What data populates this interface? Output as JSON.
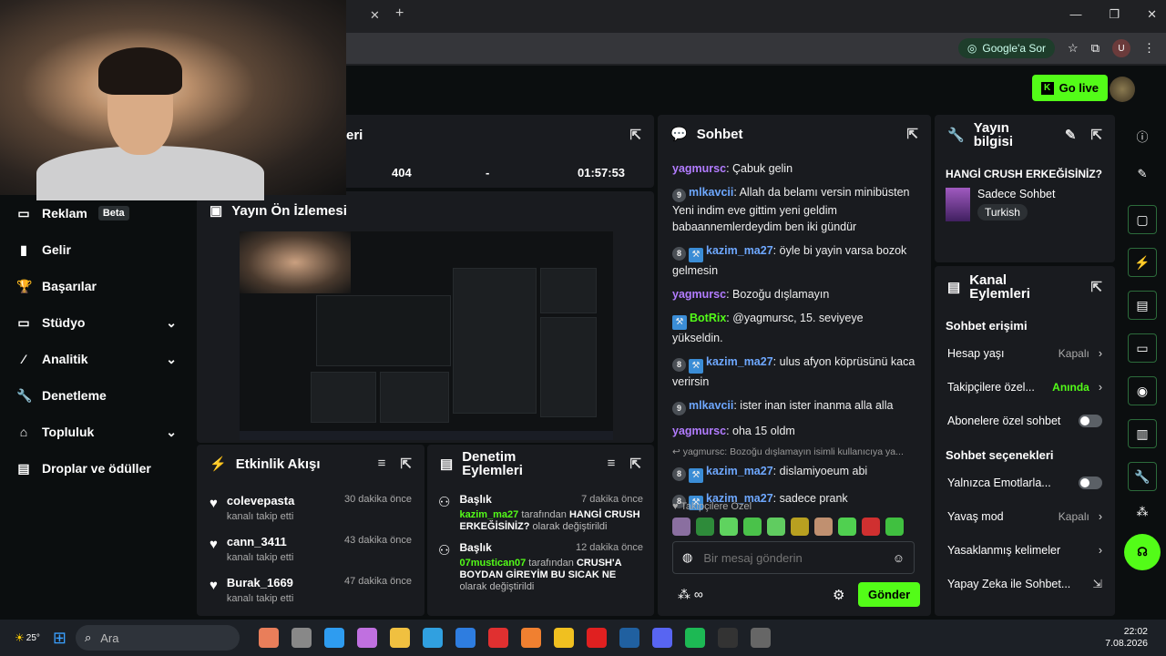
{
  "browser": {
    "google_sor": "Google'a Sor",
    "profile": "U"
  },
  "header": {
    "go_live": "Go live"
  },
  "sidebar": {
    "items": [
      {
        "label": "Reklam",
        "badge": "Beta",
        "icon": "ad-icon"
      },
      {
        "label": "Gelir",
        "icon": "chart-icon"
      },
      {
        "label": "Başarılar",
        "icon": "trophy-icon"
      },
      {
        "label": "Stüdyo",
        "icon": "studio-icon",
        "chevron": true
      },
      {
        "label": "Analitik",
        "icon": "analytics-icon",
        "chevron": true
      },
      {
        "label": "Denetleme",
        "icon": "wrench-icon"
      },
      {
        "label": "Topluluk",
        "icon": "community-icon",
        "chevron": true
      },
      {
        "label": "Droplar ve ödüller",
        "icon": "drops-icon"
      }
    ]
  },
  "stats": {
    "title_partial": "eri",
    "cells": [
      "404",
      "-",
      "01:57:53"
    ]
  },
  "preview": {
    "title": "Yayın Ön İzlemesi"
  },
  "activity": {
    "title": "Etkinlik Akışı",
    "items": [
      {
        "name": "colevepasta",
        "sub": "kanalı takip etti",
        "time": "30 dakika önce"
      },
      {
        "name": "cann_3411",
        "sub": "kanalı takip etti",
        "time": "43 dakika önce"
      },
      {
        "name": "Burak_1669",
        "sub": "kanalı takip etti",
        "time": "47 dakika önce"
      }
    ]
  },
  "moderation": {
    "title_line1": "Denetim",
    "title_line2": "Eylemleri",
    "items": [
      {
        "label": "Başlık",
        "time": "7 dakika önce",
        "user": "kazim_ma27",
        "mid": " tarafından ",
        "value": "HANGİ CRUSH ERKEĞİSİNİZ?",
        "tail": " olarak değiştirildi"
      },
      {
        "label": "Başlık",
        "time": "12 dakika önce",
        "user": "07mustican07",
        "mid": " tarafından ",
        "value": "CRUSH'A BOYDAN GİREYİM BU SICAK NE",
        "tail": " olarak değiştirildi"
      }
    ]
  },
  "chat": {
    "title": "Sohbet",
    "messages": [
      {
        "badge": "",
        "user": "yagmursc",
        "text": ": Çabuk gelin",
        "color": "#b27cff"
      },
      {
        "badge": "9",
        "user": "mlkavcii",
        "text": ": Allah da belamı versin minibüsten Yeni indim eve gittim yeni geldim babaannemlerdeydim ben iki gündür",
        "color": "#6ea8ff"
      },
      {
        "badge": "8",
        "user": "kazim_ma27",
        "text": ": öyle bi yayin varsa bozok gelmesin",
        "color": "#6ea8ff",
        "sq": true
      },
      {
        "badge": "",
        "user": "yagmursc",
        "text": ": Bozoğu dışlamayın",
        "color": "#b27cff"
      },
      {
        "badge": "",
        "user": "BotRix",
        "text": ": @yagmursc, 15. seviyeye yükseldin.",
        "color": "#53fc18",
        "sq": true
      },
      {
        "badge": "8",
        "user": "kazim_ma27",
        "text": ": ulus afyon köprüsünü kaca verirsin",
        "color": "#6ea8ff",
        "sq": true
      },
      {
        "badge": "9",
        "user": "mlkavcii",
        "text": ": ister inan ister inanma alla alla",
        "color": "#6ea8ff"
      },
      {
        "badge": "",
        "user": "yagmursc",
        "text": ": oha 15 oldm",
        "color": "#b27cff"
      }
    ],
    "reply": "yagmursc: Bozoğu dışlamayın isimli kullanıcıya ya...",
    "messages2": [
      {
        "badge": "8",
        "user": "kazim_ma27",
        "text": ": dislamiyoeum abi"
      },
      {
        "badge": "8",
        "user": "kazim_ma27",
        "text": ": sadece prank"
      }
    ],
    "followers_only": "Takipçilere Özel",
    "placeholder": "Bir mesaj gönderin",
    "send": "Gönder"
  },
  "info": {
    "title_line1": "Yayın",
    "title_line2": "bilgisi",
    "stream_title": "HANGİ CRUSH ERKEĞİSİNİZ?",
    "category": "Sadece Sohbet",
    "tag": "Turkish"
  },
  "channel": {
    "title_line1": "Kanal",
    "title_line2": "Eylemleri",
    "access": "Sohbet erişimi",
    "rows1": [
      {
        "label": "Hesap yaşı",
        "value": "Kapalı",
        "type": "chev"
      },
      {
        "label": "Takipçilere özel...",
        "value": "Anında",
        "type": "chev",
        "green": true
      },
      {
        "label": "Abonelere özel sohbet",
        "value": "",
        "type": "toggle"
      }
    ],
    "options": "Sohbet seçenekleri",
    "rows2": [
      {
        "label": "Yalnızca Emotlarla...",
        "value": "",
        "type": "toggle"
      },
      {
        "label": "Yavaş mod",
        "value": "Kapalı",
        "type": "chev"
      },
      {
        "label": "Yasaklanmış kelimeler",
        "value": "",
        "type": "chev"
      },
      {
        "label": "Yapay Zeka ile Sohbet...",
        "value": "",
        "type": "ext"
      }
    ]
  },
  "taskbar": {
    "weather": "25°",
    "search": "Ara",
    "time": "22:02",
    "date": "7.08.2026"
  },
  "colors": {
    "accent": "#53fc18",
    "panel": "#191b1f",
    "bg": "#0b0e0f"
  }
}
